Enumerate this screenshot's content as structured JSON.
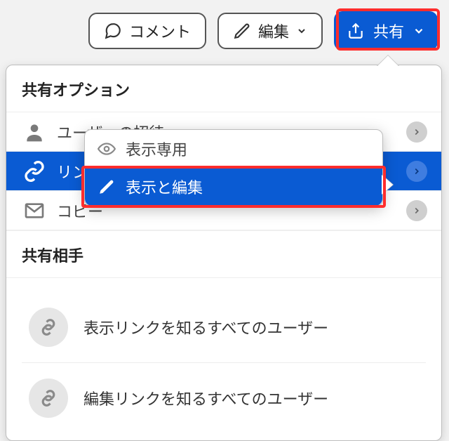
{
  "toolbar": {
    "comment": "コメント",
    "edit": "編集",
    "share": "共有"
  },
  "panel": {
    "optionsHeading": "共有オプション",
    "invite": "ユーザーの招待",
    "link": "リン",
    "copySend": "コピー",
    "shareWithHeading": "共有相手",
    "viewLinkAll": "表示リンクを知るすべてのユーザー",
    "editLinkAll": "編集リンクを知るすべてのユーザー"
  },
  "flyout": {
    "viewOnly": "表示専用",
    "viewEdit": "表示と編集"
  }
}
